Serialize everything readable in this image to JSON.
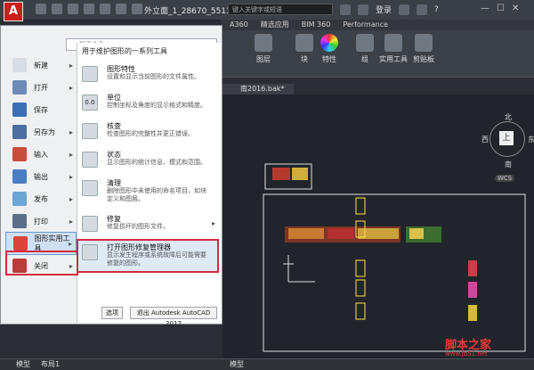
{
  "title_bar": {
    "app_button": "A",
    "document_title": "外立面_1_28670_5513...",
    "search_placeholder": "键入关键字或短语",
    "login_label": "登录",
    "help": "?"
  },
  "ribbon": {
    "tabs": [
      "A360",
      "精选应用",
      "BIM 360",
      "Performance"
    ],
    "groups": [
      {
        "label": "图层"
      },
      {
        "label": "块"
      },
      {
        "label": "特性"
      },
      {
        "label": "组"
      },
      {
        "label": "实用工具"
      },
      {
        "label": "剪贴板"
      }
    ]
  },
  "drawing": {
    "file_tab": "南2016.bak*",
    "viewcube": {
      "north": "北",
      "south": "南",
      "west": "西",
      "east": "东",
      "top": "上",
      "wcs": "WCS"
    },
    "layout_tabs": [
      "模型",
      "布局1"
    ],
    "status_label": "模型"
  },
  "app_menu": {
    "search_placeholder": "搜索命令",
    "left_items": [
      {
        "label": "新建",
        "arrow": true
      },
      {
        "label": "打开",
        "arrow": true
      },
      {
        "label": "保存",
        "arrow": false
      },
      {
        "label": "另存为",
        "arrow": true
      },
      {
        "label": "输入",
        "arrow": true
      },
      {
        "label": "输出",
        "arrow": true
      },
      {
        "label": "发布",
        "arrow": true
      },
      {
        "label": "打印",
        "arrow": true
      },
      {
        "label": "图形实用工具",
        "arrow": true
      },
      {
        "label": "关闭",
        "arrow": true
      }
    ],
    "right_header": "用于维护图形的一系列工具",
    "right_items": [
      {
        "title": "图形特性",
        "desc": "设置和显示当前图形的文件属性。",
        "icon": "",
        "arrow": false
      },
      {
        "title": "单位",
        "desc": "控制坐标及角度的显示格式和精度。",
        "icon": "0.0",
        "arrow": false
      },
      {
        "title": "核查",
        "desc": "检查图形的完整性并更正错误。",
        "icon": "",
        "arrow": false
      },
      {
        "title": "状态",
        "desc": "显示图形的统计信息、模式和范围。",
        "icon": "",
        "arrow": false
      },
      {
        "title": "清理",
        "desc": "删除图形中未使用的命名项目，如块定义和图层。",
        "icon": "",
        "arrow": false
      },
      {
        "title": "修复",
        "desc": "修复损坏的图形文件。",
        "icon": "",
        "arrow": true
      },
      {
        "title": "打开图形修复管理器",
        "desc": "显示发生程序或系统故障后可能需要修复的图形。",
        "icon": "",
        "arrow": false
      }
    ],
    "options_button": "选项",
    "exit_button": "退出 Autodesk AutoCAD 2017"
  },
  "watermark": {
    "text": "脚本之家",
    "url": "www.jb51.net"
  }
}
